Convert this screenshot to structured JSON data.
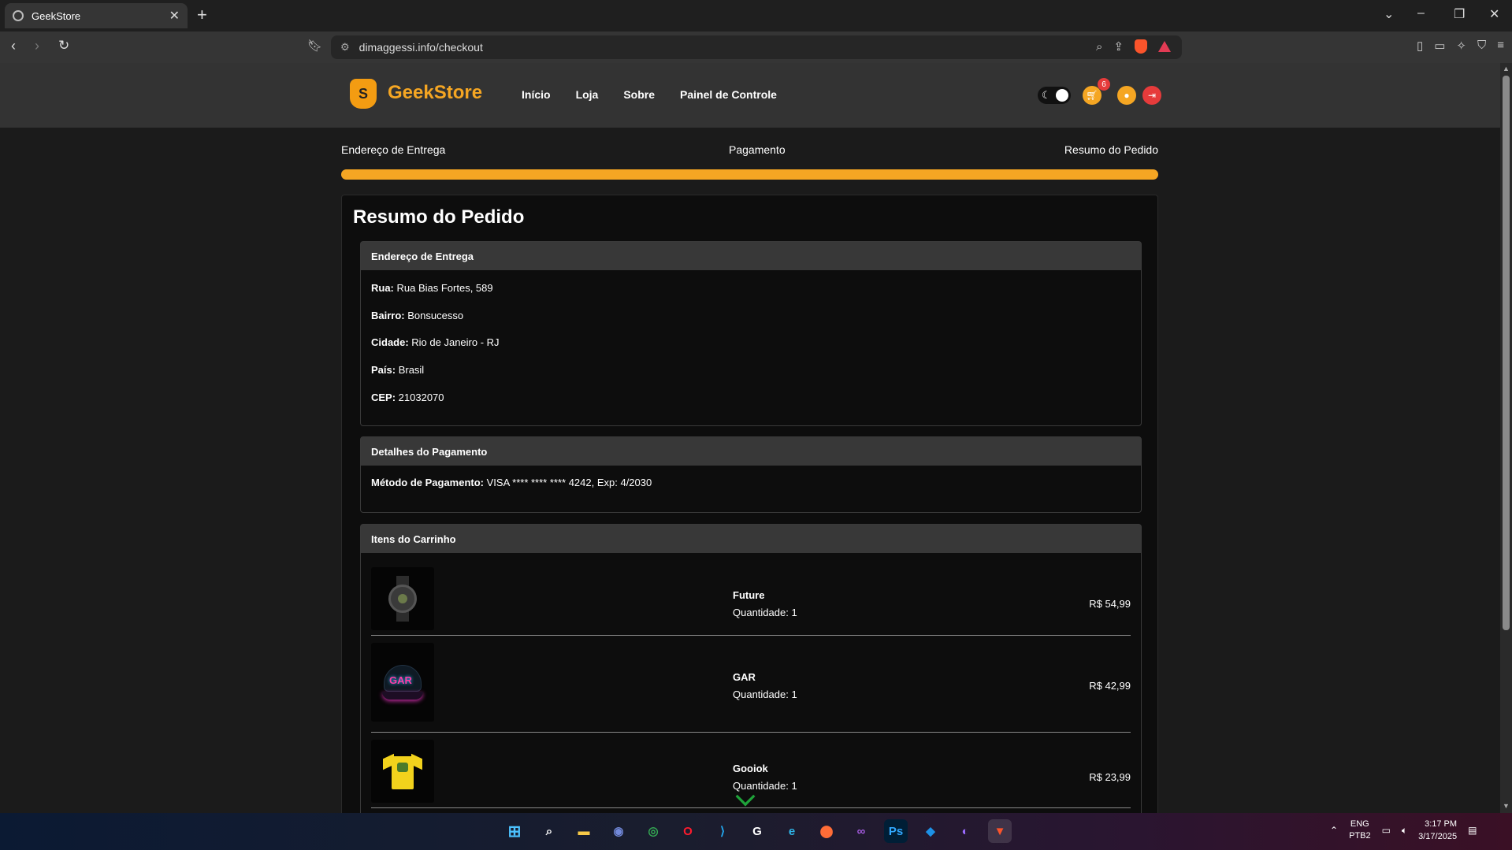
{
  "browser": {
    "tab_title": "GeekStore",
    "url": "dimaggessi.info/checkout"
  },
  "header": {
    "logo_letter": "S",
    "logo_text": "GeekStore",
    "nav": [
      "Início",
      "Loja",
      "Sobre",
      "Painel de Controle"
    ],
    "cart_count": "6"
  },
  "steps": {
    "labels": [
      "Endereço de Entrega",
      "Pagamento",
      "Resumo do Pedido"
    ],
    "progress_fraction": 1.0
  },
  "summary": {
    "title": "Resumo do Pedido",
    "address": {
      "heading": "Endereço de Entrega",
      "rows": [
        {
          "label": "Rua:",
          "value": " Rua Bias Fortes, 589"
        },
        {
          "label": "Bairro:",
          "value": " Bonsucesso"
        },
        {
          "label": "Cidade:",
          "value": " Rio de Janeiro - RJ"
        },
        {
          "label": "País:",
          "value": " Brasil"
        },
        {
          "label": "CEP:",
          "value": " 21032070"
        }
      ]
    },
    "payment": {
      "heading": "Detalhes do Pagamento",
      "label": "Método de Pagamento:",
      "value": " VISA **** **** **** 4242, Exp: 4/2030"
    },
    "cart": {
      "heading": "Itens do Carrinho",
      "items": [
        {
          "name": "Future",
          "quantity": "Quantidade: 1",
          "price": "R$ 54,99",
          "image_icon": "watch-image"
        },
        {
          "name": "GAR",
          "quantity": "Quantidade: 1",
          "price": "R$ 42,99",
          "image_icon": "cap-image",
          "image_text": "GAR"
        },
        {
          "name": "Gooiok",
          "quantity": "Quantidade: 1",
          "price": "R$ 23,99",
          "image_icon": "tshirt-image"
        }
      ]
    }
  },
  "taskbar": {
    "lang_top": "ENG",
    "lang_bottom": "PTB2",
    "time": "3:17 PM",
    "date": "3/17/2025"
  },
  "colors": {
    "accent": "#f5a623",
    "header_bg": "#333333",
    "page_bg": "#1b1b1b",
    "card_bg": "#0d0d0d"
  }
}
